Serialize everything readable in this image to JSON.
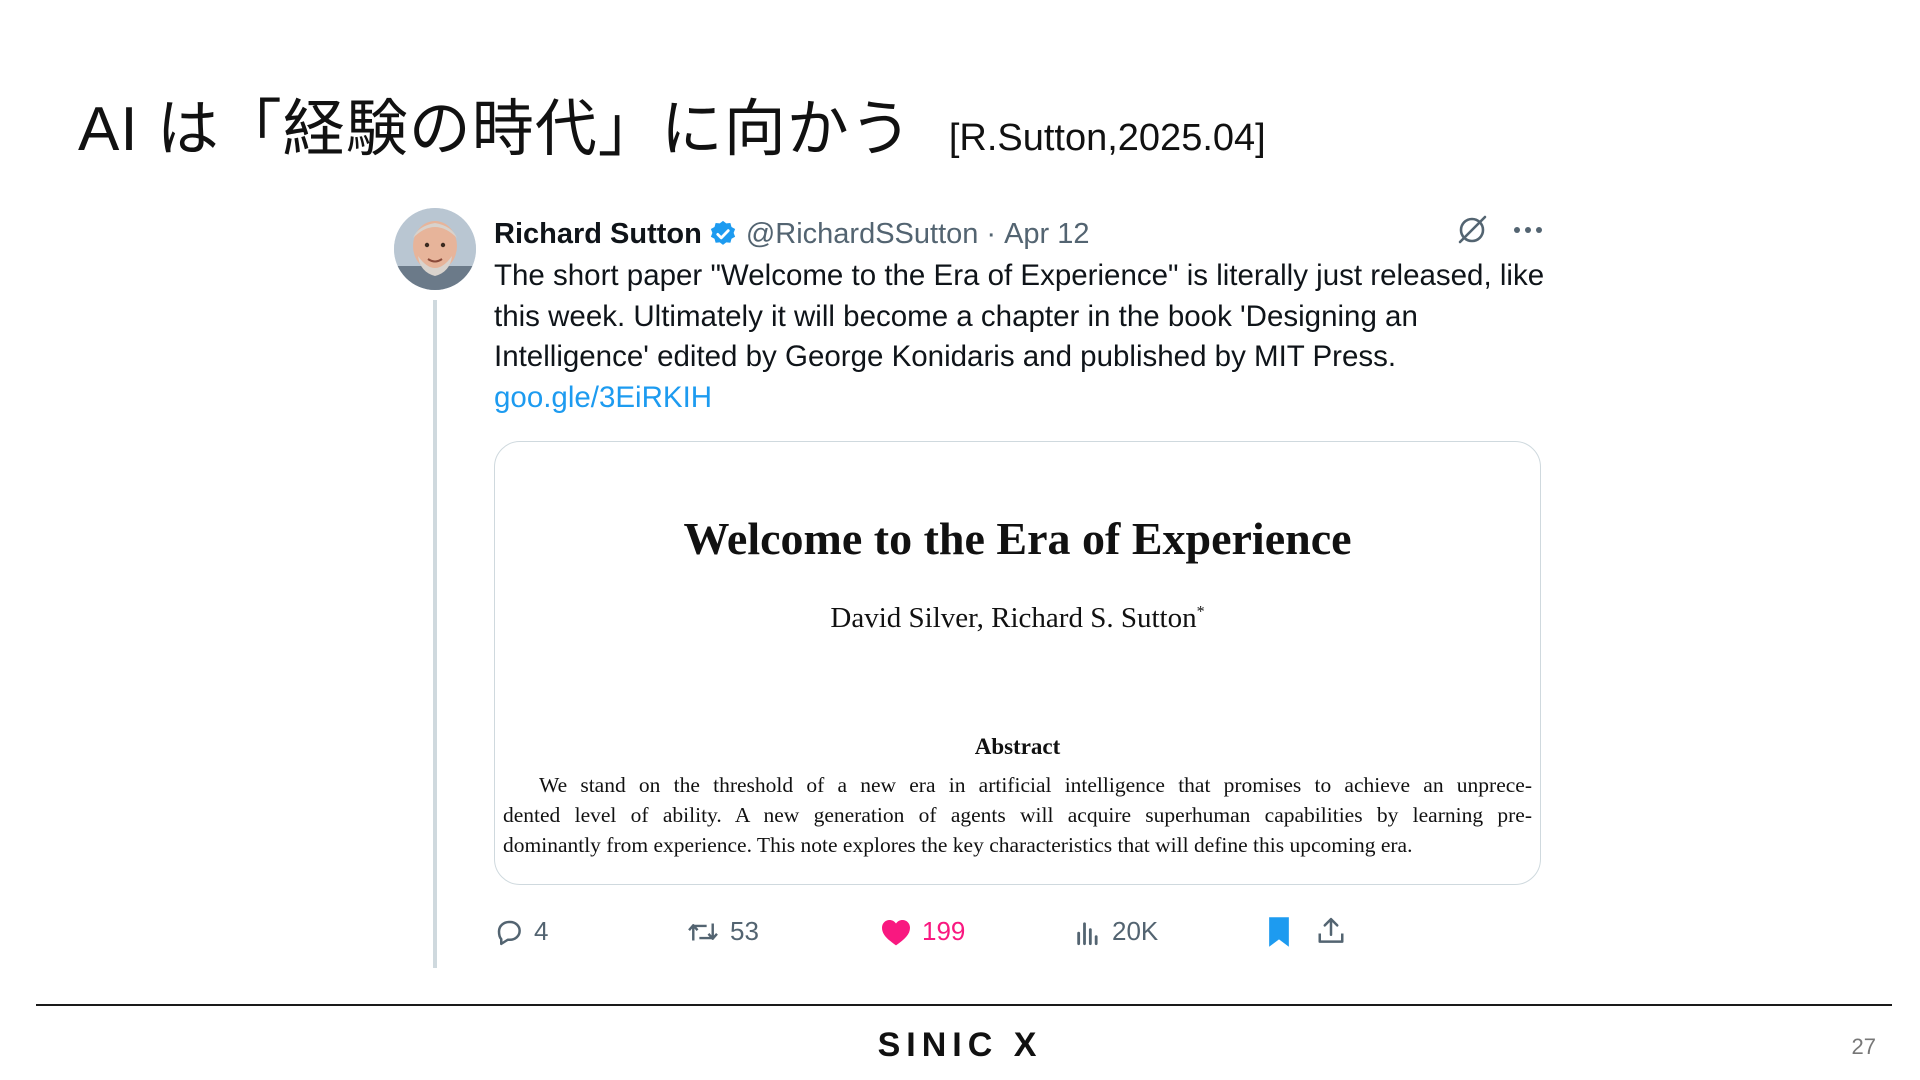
{
  "slide": {
    "title": "AI は「経験の時代」に向かう",
    "citation": "[R.Sutton,2025.04]",
    "logo": "SINIC X",
    "page_number": "27"
  },
  "tweet": {
    "author_name": "Richard Sutton",
    "handle": "@RichardSSutton",
    "separator": "·",
    "date": "Apr 12",
    "text": "The short paper \"Welcome to the Era of Experience\" is literally just released, like this week. Ultimately it will become a chapter in the book 'Designing an Intelligence' edited by George Konidaris and published by MIT Press.",
    "link": "goo.gle/3EiRKIH",
    "counts": {
      "replies": "4",
      "retweets": "53",
      "likes": "199",
      "views": "20K"
    },
    "colors": {
      "link": "#1d9bf0",
      "like": "#f91880",
      "verified": "#1d9bf0",
      "bookmark": "#1d9bf0"
    }
  },
  "paper": {
    "title": "Welcome to the Era of Experience",
    "authors": "David Silver, Richard S. Sutton",
    "authors_mark": "*",
    "abstract_heading": "Abstract",
    "abstract_lines": [
      "We stand on the threshold of a new era in artificial intelligence that promises to achieve an unprece-",
      "dented level of ability.  A new generation of agents will acquire superhuman capabilities by learning pre-",
      "dominantly from experience. This note explores the key characteristics that will define this upcoming era."
    ]
  }
}
